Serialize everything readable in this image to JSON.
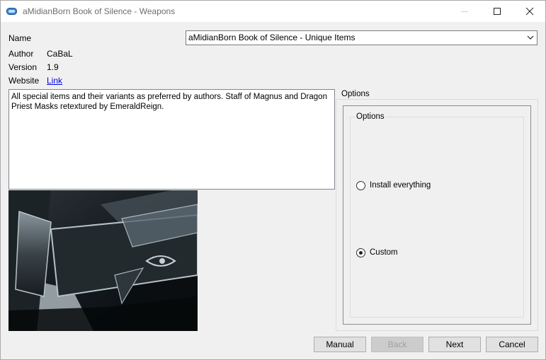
{
  "window": {
    "title": "aMidianBorn Book of Silence - Weapons"
  },
  "fields": {
    "name_label": "Name",
    "name_value": "aMidianBorn Book of Silence - Unique Items",
    "author_label": "Author",
    "author_value": "CaBaL",
    "version_label": "Version",
    "version_value": "1.9",
    "website_label": "Website",
    "website_link": "Link"
  },
  "description": "All special items and their variants as preferred by authors. Staff of Magnus and Dragon Priest Masks retextured by EmeraldReign.",
  "options": {
    "outer_label": "Options",
    "inner_label": "Options",
    "items": [
      {
        "label": "Install everything",
        "selected": false
      },
      {
        "label": "Custom",
        "selected": true
      }
    ]
  },
  "buttons": {
    "manual": "Manual",
    "back": "Back",
    "next": "Next",
    "cancel": "Cancel"
  },
  "icons": {
    "app": "app-logo-icon",
    "minimize": "minimize-icon",
    "maximize": "maximize-icon",
    "close": "close-icon",
    "dropdown": "chevron-down-icon"
  }
}
